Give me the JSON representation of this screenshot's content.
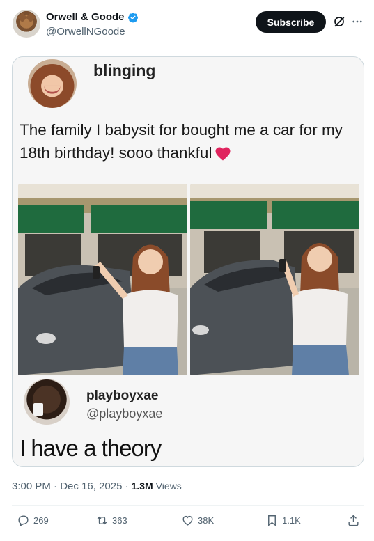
{
  "header": {
    "display_name": "Orwell & Goode",
    "handle": "@OrwellNGoode",
    "subscribe_label": "Subscribe"
  },
  "media": {
    "meme_username": "blinging",
    "meme_caption": "The family I babysit for bought me a car for my 18th birthday! sooo thankful",
    "reply_username": "playboyxae",
    "reply_handle": "@playboyxae",
    "reply_text": "I have a theory"
  },
  "meta": {
    "timestamp": "3:00 PM · Dec 16, 2025 ·",
    "views_count": "1.3M",
    "views_label": "Views"
  },
  "actions": {
    "replies": "269",
    "reposts": "363",
    "likes": "38K",
    "bookmarks": "1.1K"
  },
  "colors": {
    "verified": "#1d9bf0",
    "heart": "#e0245e",
    "text_secondary": "#536471"
  }
}
